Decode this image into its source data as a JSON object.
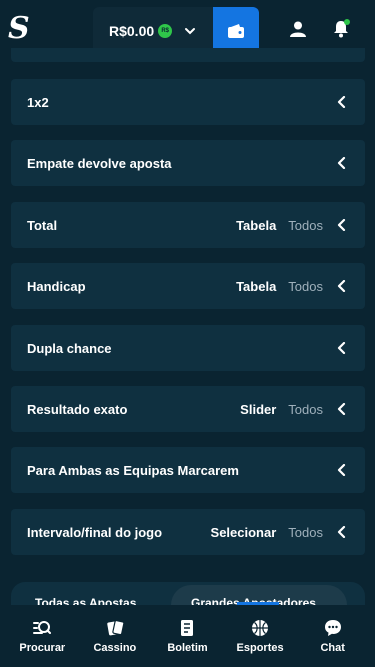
{
  "header": {
    "logo_letter": "S",
    "balance": "R$0.00",
    "currency_badge": "R$"
  },
  "markets": [
    {
      "title": "1x2",
      "option": "",
      "all": ""
    },
    {
      "title": "Empate devolve aposta",
      "option": "",
      "all": ""
    },
    {
      "title": "Total",
      "option": "Tabela",
      "all": "Todos"
    },
    {
      "title": "Handicap",
      "option": "Tabela",
      "all": "Todos"
    },
    {
      "title": "Dupla chance",
      "option": "",
      "all": ""
    },
    {
      "title": "Resultado exato",
      "option": "Slider",
      "all": "Todos"
    },
    {
      "title": "Para Ambas as Equipas Marcarem",
      "option": "",
      "all": ""
    },
    {
      "title": "Intervalo/final do jogo",
      "option": "Selecionar",
      "all": "Todos"
    }
  ],
  "subtabs": {
    "tab1": "Todas as Apostas",
    "tab2": "Grandes Apostadores"
  },
  "nav": [
    {
      "label": "Procurar",
      "icon": "search-icon"
    },
    {
      "label": "Cassino",
      "icon": "cards-icon"
    },
    {
      "label": "Boletim",
      "icon": "betslip-icon"
    },
    {
      "label": "Esportes",
      "icon": "basketball-icon"
    },
    {
      "label": "Chat",
      "icon": "chat-icon"
    }
  ],
  "colors": {
    "background": "#0a2431",
    "card": "#0f3040",
    "accent": "#1475e1",
    "badge_green": "#2fc64a",
    "muted": "#9fb0bb"
  }
}
